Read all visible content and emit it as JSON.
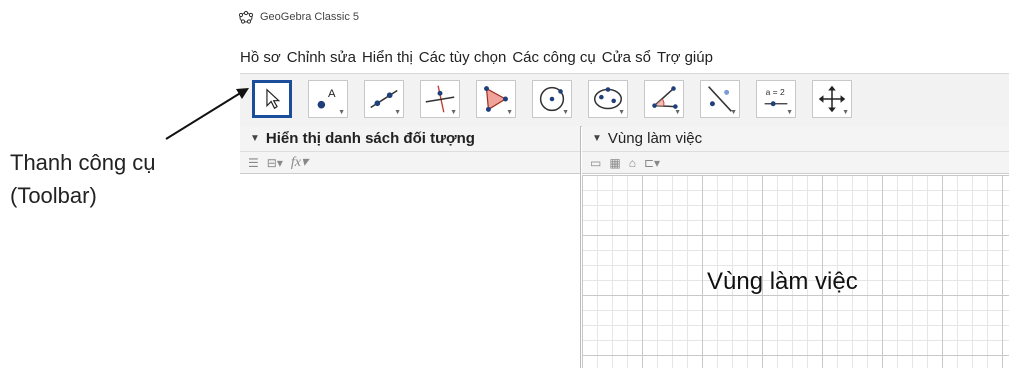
{
  "window": {
    "title": "GeoGebra Classic 5"
  },
  "menu": [
    "Hồ sơ",
    "Chỉnh sửa",
    "Hiển thị",
    "Các tùy chọn",
    "Các công cụ",
    "Cửa sổ",
    "Trợ giúp"
  ],
  "toolbar": {
    "tools": [
      {
        "name": "move-tool",
        "icon": "cursor-arrow-icon",
        "active": true
      },
      {
        "name": "point-tool",
        "icon": "point-icon"
      },
      {
        "name": "line-tool",
        "icon": "line-through-points-icon"
      },
      {
        "name": "perpendicular-line-tool",
        "icon": "perpendicular-line-icon"
      },
      {
        "name": "polygon-tool",
        "icon": "polygon-icon"
      },
      {
        "name": "circle-tool",
        "icon": "circle-center-point-icon"
      },
      {
        "name": "ellipse-tool",
        "icon": "ellipse-icon"
      },
      {
        "name": "angle-tool",
        "icon": "angle-icon"
      },
      {
        "name": "reflect-tool",
        "icon": "reflect-line-icon"
      },
      {
        "name": "slider-tool",
        "icon": "slider-icon"
      },
      {
        "name": "move-graphics-tool",
        "icon": "move-graphics-icon"
      }
    ]
  },
  "algebra_panel": {
    "title": "Hiển thị danh sách đối tượng"
  },
  "graphics_panel": {
    "title": "Vùng làm việc",
    "overlay_label": "Vùng làm việc"
  },
  "annotation": {
    "line1": "Thanh công cụ",
    "line2": "(Toolbar)"
  },
  "colors": {
    "active_tool_border": "#1b4e9a",
    "grid_major": "#c8c8c8",
    "grid_minor": "#e6e6e6"
  }
}
